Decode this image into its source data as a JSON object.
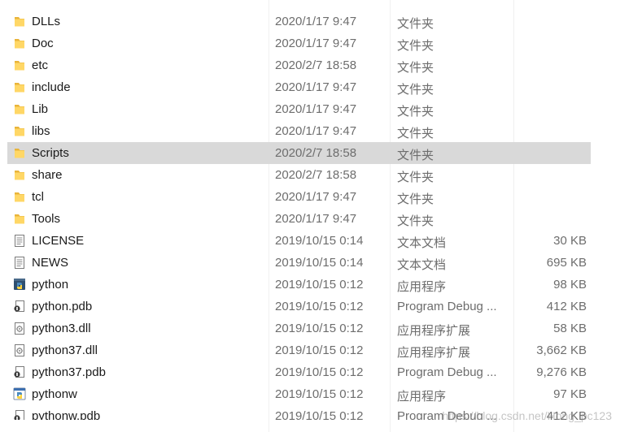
{
  "rows": [
    {
      "name": "DLLs",
      "date": "2020/1/17 9:47",
      "type": "文件夹",
      "size": "",
      "icon": "folder-icon"
    },
    {
      "name": "Doc",
      "date": "2020/1/17 9:47",
      "type": "文件夹",
      "size": "",
      "icon": "folder-icon"
    },
    {
      "name": "etc",
      "date": "2020/2/7 18:58",
      "type": "文件夹",
      "size": "",
      "icon": "folder-icon"
    },
    {
      "name": "include",
      "date": "2020/1/17 9:47",
      "type": "文件夹",
      "size": "",
      "icon": "folder-icon"
    },
    {
      "name": "Lib",
      "date": "2020/1/17 9:47",
      "type": "文件夹",
      "size": "",
      "icon": "folder-icon"
    },
    {
      "name": "libs",
      "date": "2020/1/17 9:47",
      "type": "文件夹",
      "size": "",
      "icon": "folder-icon"
    },
    {
      "name": "Scripts",
      "date": "2020/2/7 18:58",
      "type": "文件夹",
      "size": "",
      "icon": "folder-icon",
      "selected": true
    },
    {
      "name": "share",
      "date": "2020/2/7 18:58",
      "type": "文件夹",
      "size": "",
      "icon": "folder-icon"
    },
    {
      "name": "tcl",
      "date": "2020/1/17 9:47",
      "type": "文件夹",
      "size": "",
      "icon": "folder-icon"
    },
    {
      "name": "Tools",
      "date": "2020/1/17 9:47",
      "type": "文件夹",
      "size": "",
      "icon": "folder-icon"
    },
    {
      "name": "LICENSE",
      "date": "2019/10/15 0:14",
      "type": "文本文档",
      "size": "30 KB",
      "icon": "text-document-icon"
    },
    {
      "name": "NEWS",
      "date": "2019/10/15 0:14",
      "type": "文本文档",
      "size": "695 KB",
      "icon": "text-document-icon"
    },
    {
      "name": "python",
      "date": "2019/10/15 0:12",
      "type": "应用程序",
      "size": "98 KB",
      "icon": "python-app-icon"
    },
    {
      "name": "python.pdb",
      "date": "2019/10/15 0:12",
      "type": "Program Debug ...",
      "size": "412 KB",
      "icon": "debug-file-icon"
    },
    {
      "name": "python3.dll",
      "date": "2019/10/15 0:12",
      "type": "应用程序扩展",
      "size": "58 KB",
      "icon": "dll-file-icon"
    },
    {
      "name": "python37.dll",
      "date": "2019/10/15 0:12",
      "type": "应用程序扩展",
      "size": "3,662 KB",
      "icon": "dll-file-icon"
    },
    {
      "name": "python37.pdb",
      "date": "2019/10/15 0:12",
      "type": "Program Debug ...",
      "size": "9,276 KB",
      "icon": "debug-file-icon"
    },
    {
      "name": "pythonw",
      "date": "2019/10/15 0:12",
      "type": "应用程序",
      "size": "97 KB",
      "icon": "pythonw-app-icon"
    },
    {
      "name": "pythonw.pdb",
      "date": "2019/10/15 0:12",
      "type": "Program Debug ...",
      "size": "412 KB",
      "icon": "debug-file-icon",
      "partial": true
    }
  ],
  "watermark": "https://blog.csdn.net/Hong_pc123",
  "colors": {
    "selected_row": "#d9d9d9",
    "folder": "#f5c542",
    "secondary_text": "#6d6d6d"
  }
}
